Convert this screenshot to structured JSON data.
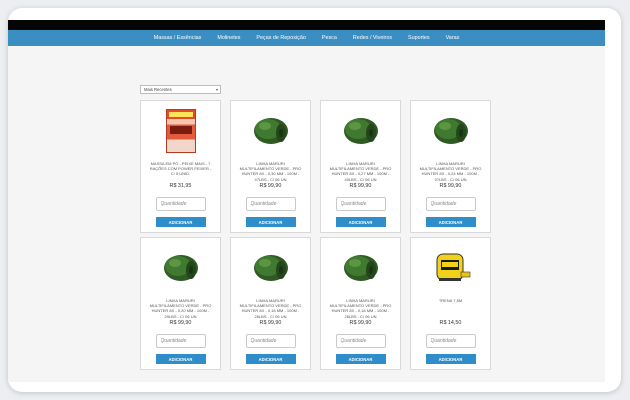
{
  "nav": [
    "Massas / Essências",
    "Molinetes",
    "Peças de Reposição",
    "Pesca",
    "Redes / Viveiros",
    "Suportes",
    "Varas"
  ],
  "sort": {
    "selected": "Mais Recentes"
  },
  "qty_placeholder": "Quantidade",
  "add_label": "ADICIONAR",
  "products": [
    {
      "name": "MASSA EM PÓ - PEIXE MAIS - 7 RAÇÕES COM POWER FEIXER - C/ 5 UNID.",
      "price": "R$ 31,95",
      "icon": "bait-package-icon"
    },
    {
      "name": "LINHA MARURI MULTIFILAMENTO VERDE - PRO HUNTER 8X - 0,30 MM - 100M - 47LBS - C/ 06 UN",
      "price": "R$ 99,90",
      "icon": "fishing-line-spool-icon"
    },
    {
      "name": "LINHA MARURI MULTIFILAMENTO VERDE - PRO HUNTER 8X - 0,27 MM - 100M - 40LBS - C/ 06 UN",
      "price": "R$ 99,90",
      "icon": "fishing-line-spool-icon"
    },
    {
      "name": "LINHA MARURI MULTIFILAMENTO VERDE - PRO HUNTER 8X - 0,24 MM - 100M - 37LBS - C/ 06 UN",
      "price": "R$ 99,90",
      "icon": "fishing-line-spool-icon"
    },
    {
      "name": "LINHA MARURI MULTIFILAMENTO VERDE - PRO HUNTER 8X - 0,20 MM - 100M - 29LBS - C/ 06 UN",
      "price": "R$ 99,90",
      "icon": "fishing-line-spool-icon"
    },
    {
      "name": "LINHA MARURI MULTIFILAMENTO VERDE - PRO HUNTER 8X - 0,18 MM - 100M - 26LBS - C/ 06 UN",
      "price": "R$ 99,90",
      "icon": "fishing-line-spool-icon"
    },
    {
      "name": "LINHA MARURI MULTIFILAMENTO VERDE - PRO HUNTER 8X - 0,18 MM - 100M - 26LBS - C/ 06 UN",
      "price": "R$ 99,90",
      "icon": "fishing-line-spool-icon"
    },
    {
      "name": "TRENA 7,5M",
      "price": "R$ 14,50",
      "icon": "tape-measure-icon"
    }
  ]
}
